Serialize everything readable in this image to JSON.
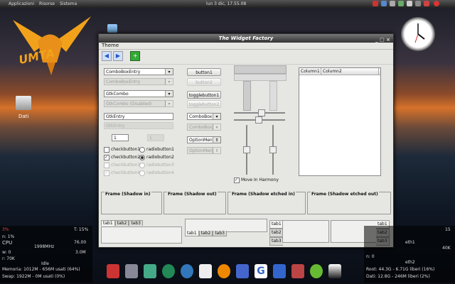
{
  "top_panel": {
    "menu_items": [
      "Applicazioni",
      "Risorse",
      "Sistema"
    ],
    "clock": "lun 3 dic, 17.55.08"
  },
  "desktop": {
    "logo_text": "UMTA",
    "icon_label": "Dati"
  },
  "window": {
    "title": "The Widget Factory",
    "menu": "Theme",
    "combos": [
      "ComboBoxEntry",
      "ComboBoxEntry",
      "GtkCombo",
      "GtkCombo (Disabled)"
    ],
    "entries": [
      "GtkEntry",
      "GtkEntry"
    ],
    "spin_values": [
      "1",
      "1"
    ],
    "buttons": [
      "button1",
      "button2",
      "togglebutton1",
      "togglebutton2",
      "ComboBox",
      "ComboBox",
      "OptionMenu",
      "OptionMenu"
    ],
    "checks": [
      "checkbutton1",
      "checkbutton2",
      "checkbutton3",
      "checkbutton4"
    ],
    "radios": [
      "radiobutton1",
      "radiobutton2",
      "radiobutton3",
      "radiobutton4"
    ],
    "move_harmony": "Move In Harmony",
    "list_columns": [
      "Column1",
      "Column2"
    ],
    "frames": [
      "Frame (Shadow in)",
      "Frame (Shadow out)",
      "Frame (Shadow etched in)",
      "Frame (Shadow etched out)"
    ],
    "tabs": [
      "tab1",
      "tab2",
      "tab3"
    ]
  },
  "left_stats": {
    "lines": [
      "CPU",
      "1998MHz",
      "76.00",
      "Idle",
      "Memoria: 1012M - 656M usati (64%)",
      "Swap: 1922M - 0M usati (0%)"
    ],
    "t_value": "T: 15%",
    "percent": "3%",
    "n_value": "n: 1%",
    "w_value": "w: 0",
    "r_value": "r: 70K",
    "r2_value": "n: 1%",
    "memory_value": "3.0M"
  },
  "right_stats": {
    "eth1": "eth1",
    "eth2": "eth2",
    "value_top": "15",
    "value_mid": "40K",
    "value_n": "n: 0",
    "root_line": "Root: 44.3G - 6.71G liberi (16%)",
    "dati_line": "Dati: 12.8G - 246M liberi (2%)"
  },
  "colors": {
    "accent": "#2255cc",
    "window_bg": "#e6e6e2"
  }
}
